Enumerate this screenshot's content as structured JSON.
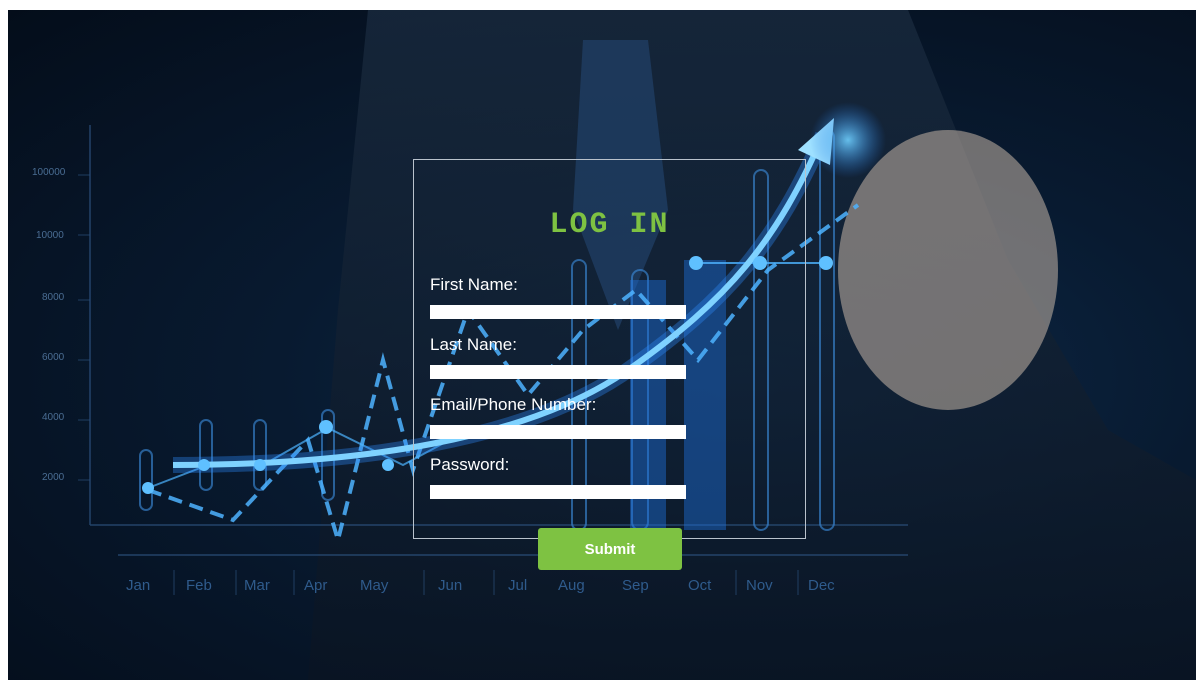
{
  "background": {
    "y_ticks": [
      "100000",
      "10000",
      "8000",
      "6000",
      "4000",
      "2000"
    ],
    "months": [
      "Jan",
      "Feb",
      "Mar",
      "Apr",
      "May",
      "Jun",
      "Jul",
      "Aug",
      "Sep",
      "Oct",
      "Nov",
      "Dec"
    ]
  },
  "form": {
    "title": "LOG IN",
    "fields": [
      {
        "label": "First Name:",
        "value": "",
        "placeholder": ""
      },
      {
        "label": "Last Name:",
        "value": "",
        "placeholder": ""
      },
      {
        "label": "Email/Phone Number:",
        "value": "",
        "placeholder": ""
      },
      {
        "label": "Password:",
        "value": "",
        "placeholder": ""
      }
    ],
    "submit_label": "Submit"
  },
  "colors": {
    "accent": "#7ec242",
    "glow": "#3fa9ff",
    "background": "#061426"
  }
}
